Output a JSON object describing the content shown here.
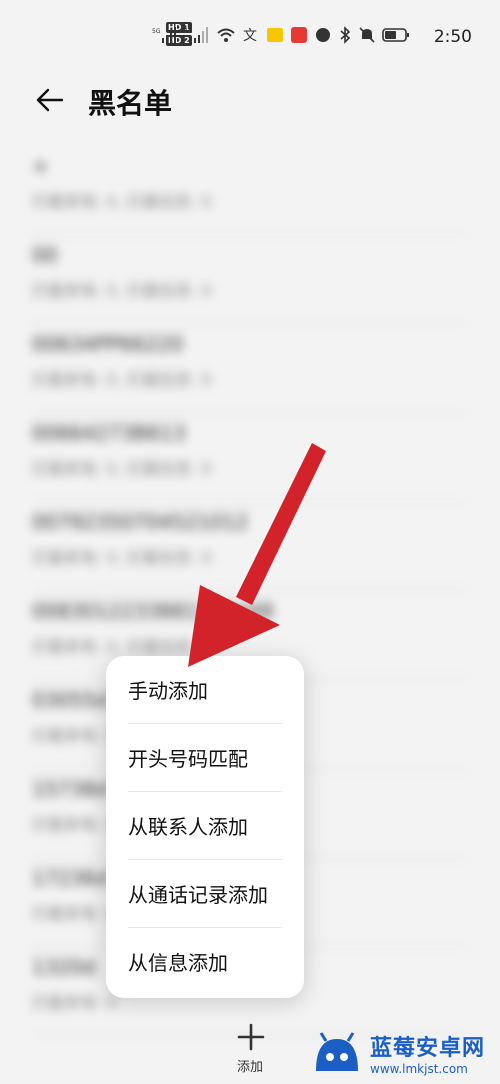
{
  "status_bar": {
    "time": "2:50",
    "hd1": "HD 1",
    "hd2": "HD 2",
    "net1": "5G",
    "net2": "4G"
  },
  "header": {
    "title": "黑名单"
  },
  "list": [
    {
      "number": "+",
      "sub": "拦截来电: 0,  拦截信息: 0"
    },
    {
      "number": "00",
      "sub": "拦截来电: 0,  拦截信息: 0"
    },
    {
      "number": "00634PP66220",
      "sub": "拦截来电: 0,  拦截信息: 0"
    },
    {
      "number": "00664273B613",
      "sub": "拦截来电: 0,  拦截信息: 0"
    },
    {
      "number": "00792350704521012",
      "sub": "拦截来电: 0,  拦截信息: 0"
    },
    {
      "number": "0083012233881335448",
      "sub": "拦截来电: 0,  拦截信息: 0"
    },
    {
      "number": "03055d",
      "sub": "拦截来电: 0"
    },
    {
      "number": "15738d",
      "sub": "拦截来电: 0"
    },
    {
      "number": "17236d",
      "sub": "拦截来电: 0"
    },
    {
      "number": "1320d",
      "sub": "拦截来电: 0"
    }
  ],
  "menu": {
    "items": [
      "手动添加",
      "开头号码匹配",
      "从联系人添加",
      "从通话记录添加",
      "从信息添加"
    ]
  },
  "bottom": {
    "add_label": "添加"
  },
  "watermark": {
    "title": "蓝莓安卓网",
    "url": "www.lmkjst.com"
  },
  "colors": {
    "arrow": "#d2232a",
    "watermark": "#1c5fc4"
  }
}
